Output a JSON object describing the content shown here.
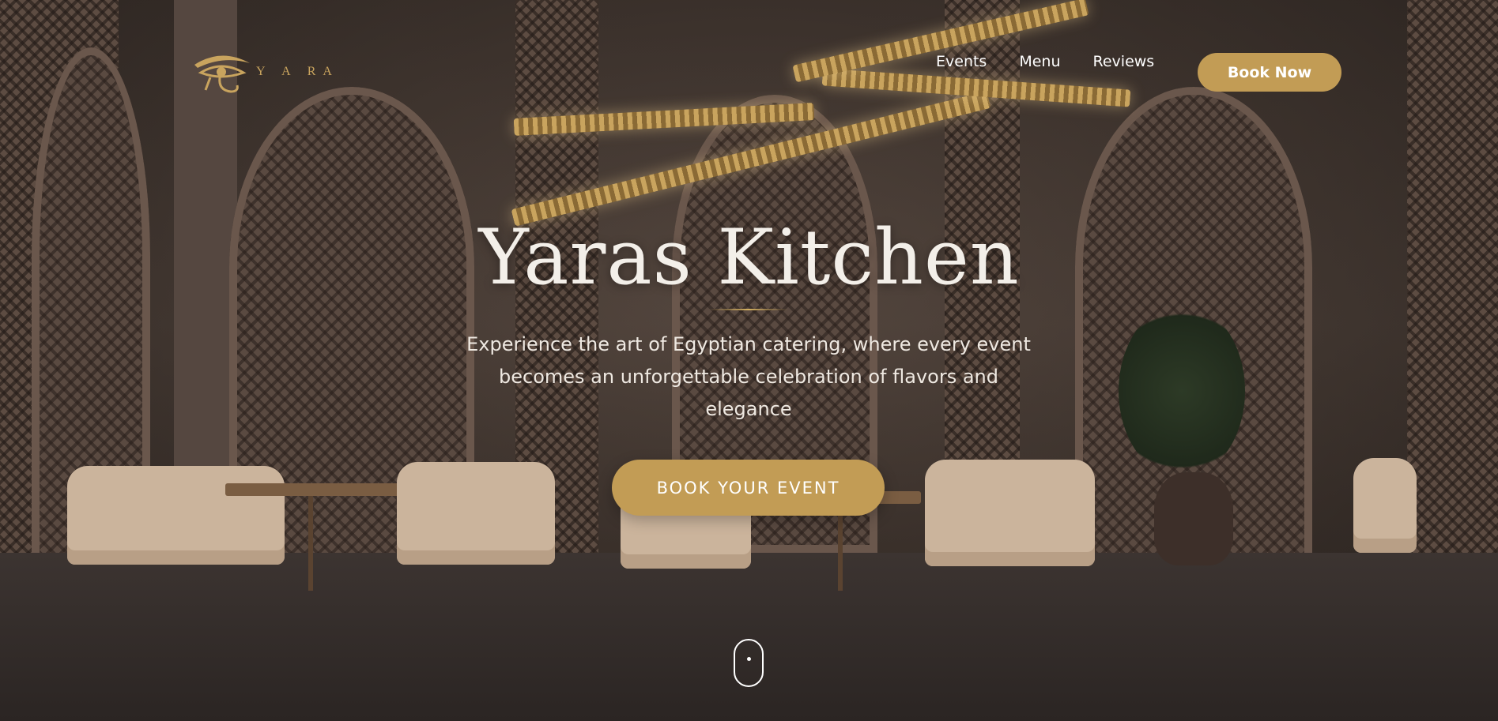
{
  "brand": {
    "logo_text": "Y A RA"
  },
  "nav": {
    "items": [
      "Events",
      "Menu",
      "Reviews"
    ],
    "book_now": "Book Now"
  },
  "hero": {
    "title": "Yaras Kitchen",
    "subtitle": "Experience the art of Egyptian catering, where every event becomes an unforgettable celebration of flavors and elegance",
    "cta": "BOOK YOUR EVENT"
  },
  "colors": {
    "accent": "#c29c55",
    "text": "#ffffff"
  }
}
